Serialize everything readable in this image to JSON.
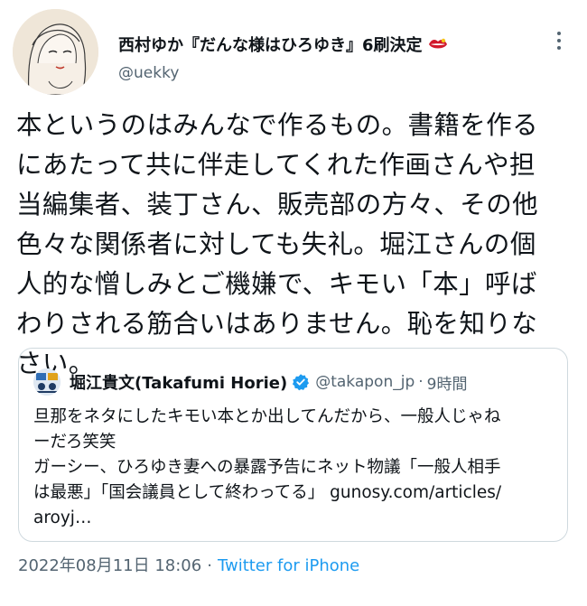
{
  "author": {
    "display_name": "西村ゆか『だんな様はひろゆき』6刷決定",
    "handle": "@uekky",
    "avatar_icon": "illustrated-woman-avatar",
    "badge_icon": "lips-emoji-icon"
  },
  "tweet": {
    "text": "本というのはみんなで作るもの。書籍を作る\nにあたって共に伴走してくれた作画さんや担\n当編集者、装丁さん、販売部の方々、その他\n色々な関係者に対しても失礼。堀江さんの個\n人的な憎しみとご機嫌で、キモい「本」呼ば\nわりされる筋合いはありません。恥を知りな\nさい。",
    "timestamp": "2022年08月11日 18:06",
    "separator": "·",
    "source": "Twitter for iPhone"
  },
  "quote": {
    "display_name": "堀江貴文(Takafumi Horie)",
    "handle": "@takapon_jp",
    "separator": "·",
    "time": "9時間",
    "text": "旦那をネタにしたキモい本とか出してんだから、一般人じゃね\nーだろ笑笑\nガーシー、ひろゆき妻への暴露予告にネット物議「一般人相手\nは最悪」「国会議員として終わってる」 gunosy.com/articles/\naroyj…",
    "avatar_icon": "book-cover-avatar",
    "verified_icon": "verified-badge-icon"
  },
  "colors": {
    "text": "#0f1419",
    "secondary": "#536471",
    "link": "#1d9bf0",
    "border": "#cfd9de",
    "verified": "#1d9bf0"
  }
}
